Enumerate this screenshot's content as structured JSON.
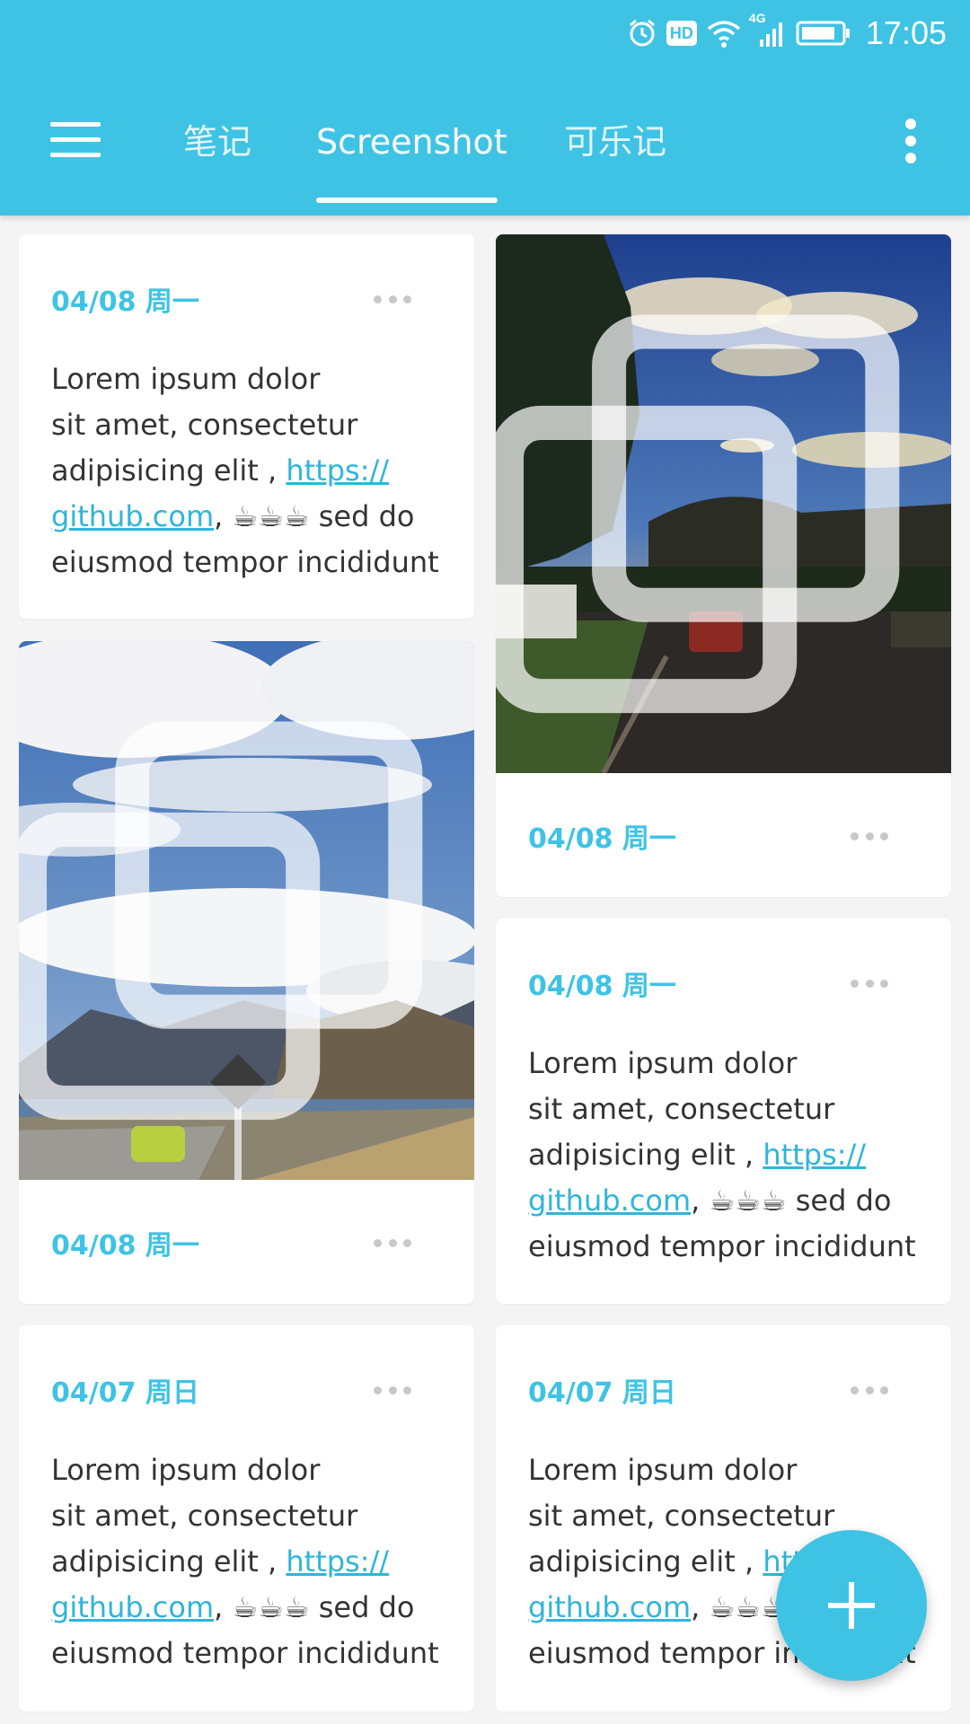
{
  "status_bar": {
    "time": "17:05",
    "hd_label": "HD",
    "network_label": "4G"
  },
  "tabs": [
    {
      "label": "笔记"
    },
    {
      "label": "Screenshot"
    },
    {
      "label": "可乐记"
    }
  ],
  "active_tab": "Screenshot",
  "note_text": {
    "line1": "Lorem ipsum dolor",
    "line2": "sit amet, consectetur",
    "line3_pre": "adipisicing  elit , ",
    "link_part1": "https://",
    "link_part2": "github.com",
    "after_link": ", ☕☕☕ sed do",
    "line5": "eiusmod tempor incididunt"
  },
  "cards": [
    {
      "date": "04/08 周一"
    },
    {
      "date": "04/08 周一",
      "image": "street-sunset-photo"
    },
    {
      "date": "04/08 周一",
      "image": "mountain-lake-photo"
    },
    {
      "date": "04/08 周一"
    },
    {
      "date": "04/07 周日"
    },
    {
      "date": "04/07 周日"
    }
  ],
  "colors": {
    "accent": "#3fc3e4",
    "link": "#2fb5da",
    "background": "#f4f4f4"
  },
  "icons": [
    "menu-icon",
    "more-vert-icon",
    "alarm-icon",
    "wifi-icon",
    "signal-icon",
    "battery-icon",
    "more-horiz-icon",
    "copy-icon",
    "add-icon"
  ]
}
